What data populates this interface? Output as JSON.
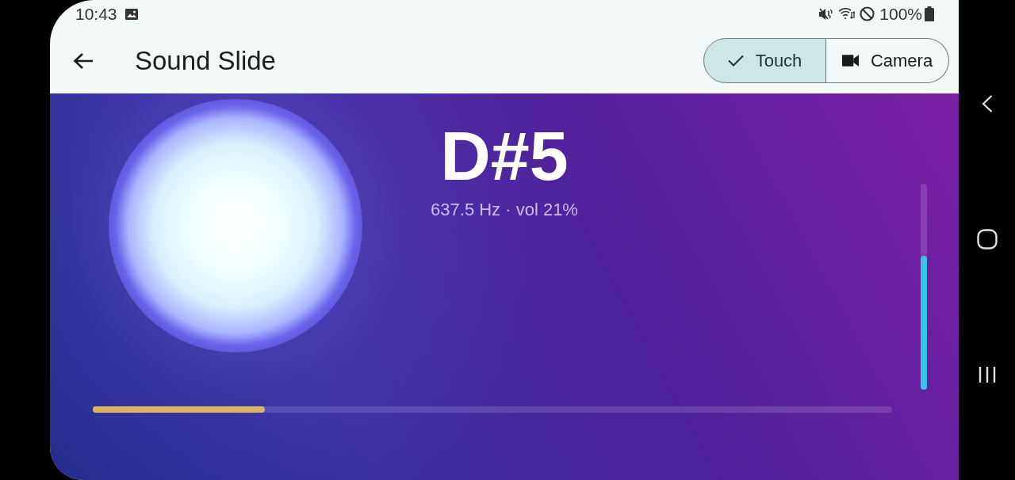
{
  "status_bar": {
    "time": "10:43",
    "battery": "100%"
  },
  "app_bar": {
    "title": "Sound Slide"
  },
  "mode_toggle": [
    {
      "label": "Touch",
      "kind": "touch",
      "selected": true
    },
    {
      "label": "Camera",
      "kind": "camera",
      "selected": false
    }
  ],
  "stage": {
    "note": "D#5",
    "reading": "637.5 Hz · vol 21%",
    "horizontal_bar": {
      "level": 0.215
    },
    "vertical_bar": {
      "level": 0.65
    }
  }
}
